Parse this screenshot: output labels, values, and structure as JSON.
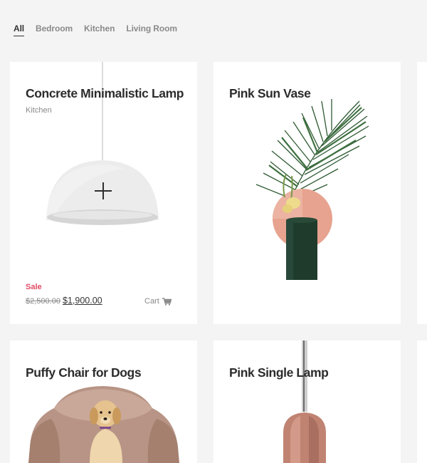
{
  "filters": [
    {
      "label": "All",
      "active": true
    },
    {
      "label": "Bedroom"
    },
    {
      "label": "Kitchen"
    },
    {
      "label": "Living Room"
    }
  ],
  "products": [
    {
      "title": "Concrete Minimalistic Lamp",
      "category": "Kitchen",
      "sale_label": "Sale",
      "old_price": "$2,500.00",
      "price": "$1,900.00",
      "cart_label": "Cart"
    },
    {
      "title": "Pink Sun Vase"
    },
    {
      "title": "Puffy Chair for Dogs"
    },
    {
      "title": "Pink Single Lamp"
    }
  ],
  "colors": {
    "background": "#f4f4f4",
    "card": "#ffffff",
    "sale": "#e14b64",
    "text": "#2c2c2c",
    "muted": "#888888"
  },
  "icons": {
    "cart": "shopping-cart-icon",
    "zoom": "plus-icon"
  }
}
